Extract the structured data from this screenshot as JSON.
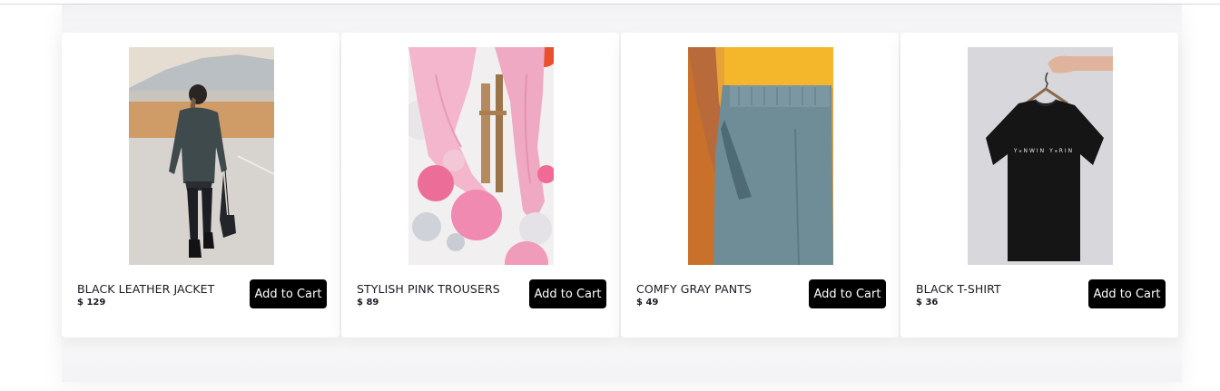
{
  "products": [
    {
      "name": "BLACK LEATHER JACKET",
      "price": "$ 129",
      "button_label": "Add to Cart",
      "image": "woman-leather-jacket-photo"
    },
    {
      "name": "STYLISH PINK TROUSERS",
      "price": "$ 89",
      "button_label": "Add to Cart",
      "image": "pink-trousers-balloons-photo"
    },
    {
      "name": "COMFY GRAY PANTS",
      "price": "$ 49",
      "button_label": "Add to Cart",
      "image": "gray-pants-yellow-top-photo"
    },
    {
      "name": "BLACK T-SHIRT",
      "price": "$ 36",
      "button_label": "Add to Cart",
      "image": "black-tshirt-hanger-photo"
    }
  ],
  "colors": {
    "button_bg": "#000000",
    "button_text": "#ffffff",
    "card_bg": "#ffffff"
  }
}
